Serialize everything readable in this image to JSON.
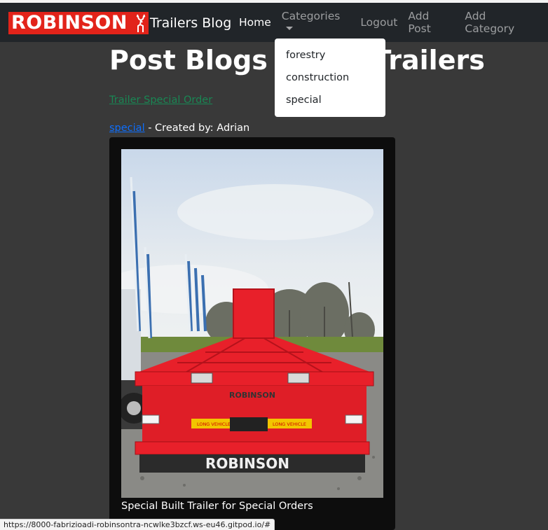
{
  "navbar": {
    "logo_text": "ROBINSON",
    "brand_text": "Trailers Blog",
    "items": {
      "home": "Home",
      "categories": "Categories",
      "logout": "Logout",
      "add_post": "Add Post",
      "add_category": "Add Category"
    }
  },
  "dropdown": {
    "items": [
      "forestry",
      "construction",
      "special"
    ]
  },
  "main": {
    "title": "Post Blogs about Trailers",
    "post_link": "Trailer Special Order",
    "category_link": "special",
    "created_by": " - Created by: Adrian",
    "image_caption": "Special Built Trailer for Special Orders",
    "trailer_brand_text": "ROBINSON",
    "plate_text": "LONG VEHICLE"
  },
  "status_bar": {
    "url": "https://8000-fabrizioadi-robinsontra-ncwlke3bzcf.ws-eu46.gitpod.io/#"
  },
  "colors": {
    "navbar_bg": "#212529",
    "page_bg": "#393939",
    "logo_red": "#e2231a",
    "link_green": "#198754",
    "link_blue": "#0d6efd",
    "trailer_red": "#e8202a"
  }
}
